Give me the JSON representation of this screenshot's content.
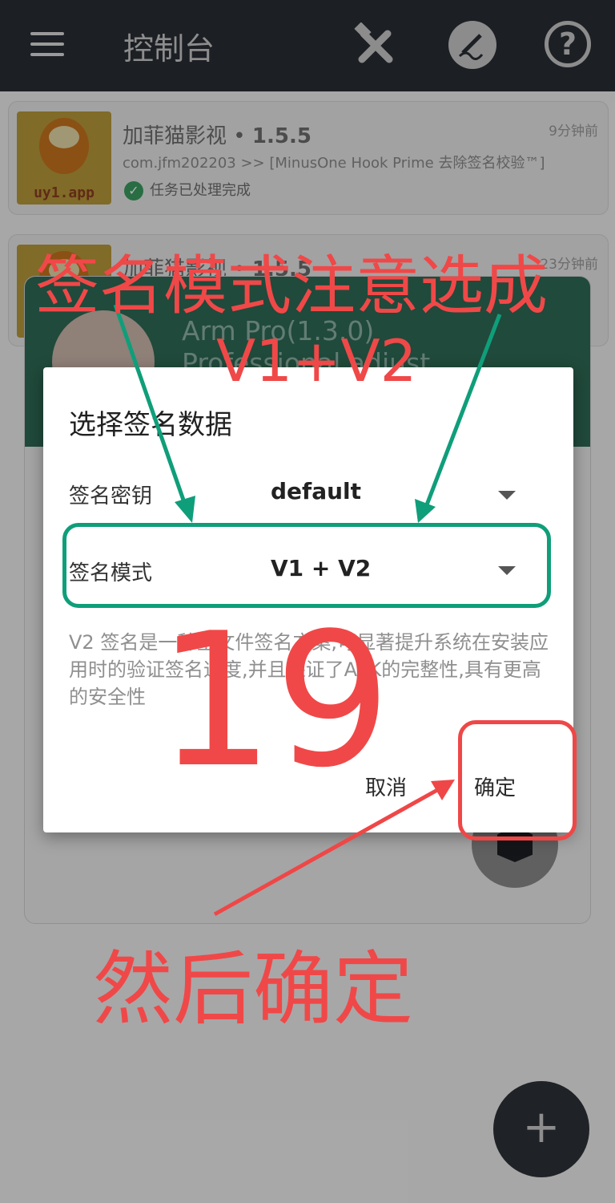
{
  "topbar": {
    "title": "控制台",
    "icons": {
      "menu": "menu-icon",
      "tools": "tools-icon",
      "sign": "signature-icon",
      "help": "help-icon"
    },
    "help_glyph": "?"
  },
  "task_list": [
    {
      "thumb_label": "uy1.app",
      "name": "加菲猫影视",
      "version": "1.5.5",
      "package": "com.jfm202203 >> [MinusOne Hook Prime 去除签名校验™]",
      "time": "9分钟前",
      "status": "任务已处理完成"
    },
    {
      "name": "加菲猫影视",
      "version": "1.5.5",
      "time": "23分钟前"
    }
  ],
  "arm_panel": {
    "line1": "Arm Pro(1.3.0)",
    "line2": "Professional adjust"
  },
  "dialog": {
    "title": "选择签名数据",
    "key_label": "签名密钥",
    "key_value": "default",
    "mode_label": "签名模式",
    "mode_value": "V1 + V2",
    "description": "V2 签名是一种全文件签名方案,可显著提升系统在安装应用时的验证签名速度,并且保证了APK的完整性,具有更高的安全性",
    "cancel_label": "取消",
    "confirm_label": "确定"
  },
  "annotations": {
    "top_text": "签名模式注意选成",
    "mode_text": "V1+V2",
    "step_number": "19",
    "bottom_text": "然后确定"
  },
  "fab": {
    "label": "+"
  },
  "colors": {
    "annotation_red": "#f04848",
    "annotation_green": "#0f9e7a",
    "topbar": "#1c1f24",
    "arm_header": "#2e6a55"
  }
}
